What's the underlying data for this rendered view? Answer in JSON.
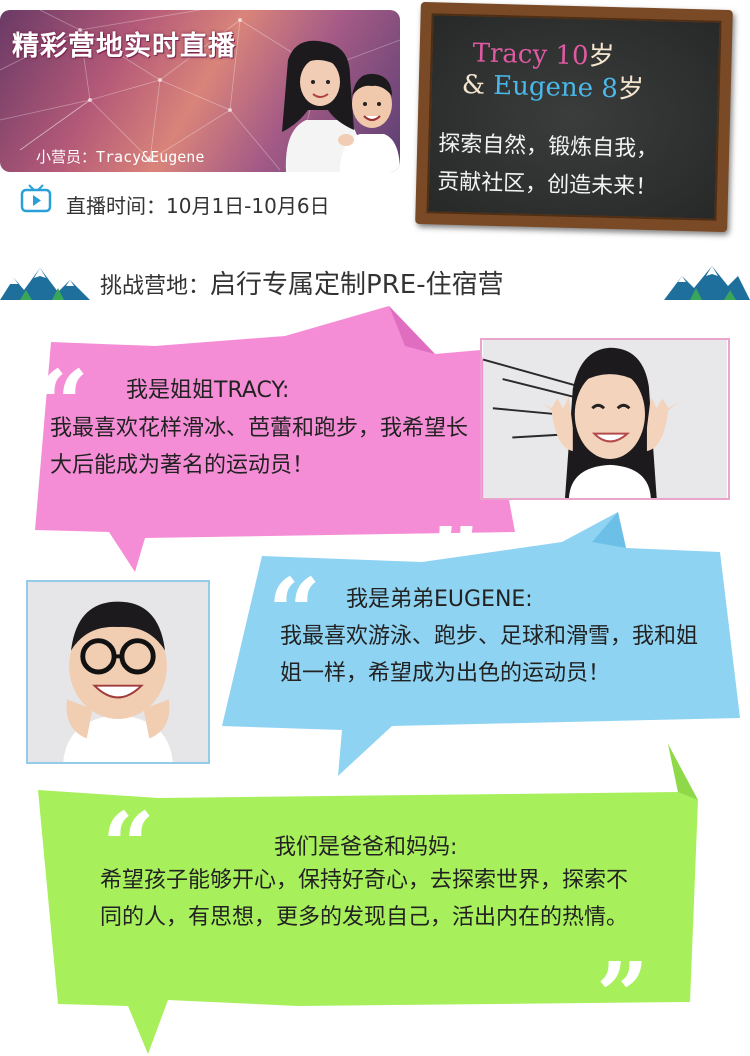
{
  "banner": {
    "title": "精彩营地实时直播",
    "subtitle": "小营员：Tracy&Eugene"
  },
  "live": {
    "icon": "tv-play-icon",
    "text": "直播时间：10月1日-10月6日"
  },
  "chalkboard": {
    "name1": "Tracy 10",
    "age1_unit": "岁",
    "amp": "&",
    "name2": "Eugene 8",
    "age2_unit": "岁",
    "line3": "探索自然，锻炼自我，",
    "line4": "贡献社区，创造未来！"
  },
  "section": {
    "lead": "挑战营地：",
    "title": "启行专属定制PRE-住宿营"
  },
  "bubbles": {
    "tracy": {
      "heading": "我是姐姐TRACY:",
      "body": "我最喜欢花样滑冰、芭蕾和跑步，我希望长大后能成为著名的运动员！"
    },
    "eugene": {
      "heading": "我是弟弟EUGENE:",
      "body": "我最喜欢游泳、跑步、足球和滑雪，我和姐姐一样，希望成为出色的运动员！"
    },
    "parents": {
      "heading": "我们是爸爸和妈妈:",
      "body": "希望孩子能够开心，保持好奇心，去探索世界，探索不同的人，有思想，更多的发现自己，活出内在的热情。"
    }
  },
  "colors": {
    "pink": "#f58dd6",
    "blue": "#8ed3f2",
    "green": "#a8ef5c",
    "board_frame": "#7a4a26",
    "board_pink": "#e05aa3",
    "board_blue": "#4ab8e8"
  }
}
